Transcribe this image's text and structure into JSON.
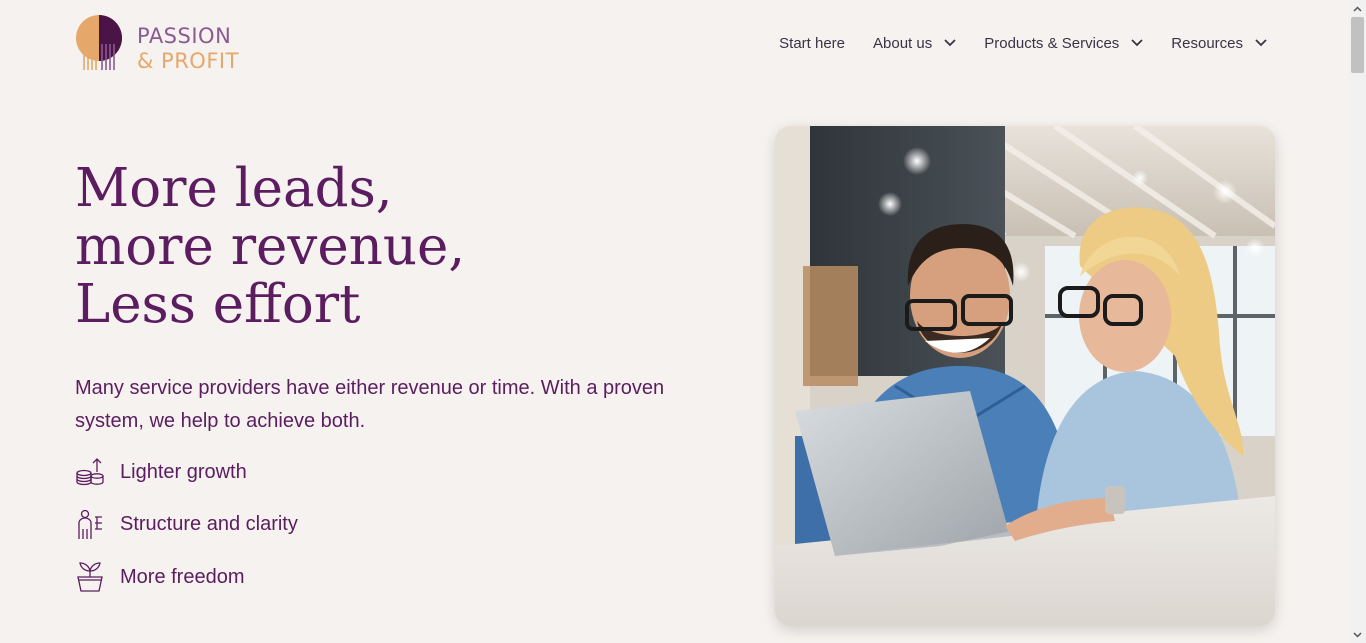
{
  "brand": {
    "line1": "PASSION",
    "line2": "& PROFIT",
    "accent_purple": "#5b1d5f",
    "accent_orange": "#e6a86a"
  },
  "nav": {
    "start_here": "Start here",
    "about_us": "About us",
    "products_services": "Products & Services",
    "resources": "Resources"
  },
  "hero": {
    "title_line1": "More leads,",
    "title_line2": "more revenue,",
    "title_line3": "Less effort",
    "subtitle": "Many service providers have either revenue or time. With a proven system, we help to achieve both.",
    "features": [
      {
        "icon": "coins-growth-icon",
        "label": "Lighter growth"
      },
      {
        "icon": "person-structure-icon",
        "label": "Structure and clarity"
      },
      {
        "icon": "plant-pot-icon",
        "label": "More freedom"
      }
    ]
  },
  "image": {
    "subject": "smiling-couple-laptop-photo"
  }
}
